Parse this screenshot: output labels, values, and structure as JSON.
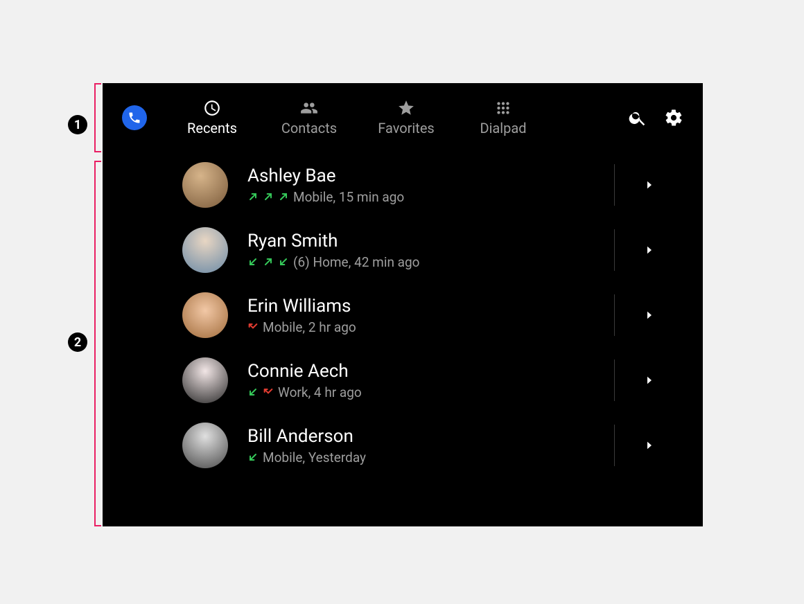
{
  "annotations": {
    "badge1": "1",
    "badge2": "2"
  },
  "header": {
    "tabs": [
      {
        "id": "recents",
        "label": "Recents",
        "active": true
      },
      {
        "id": "contacts",
        "label": "Contacts",
        "active": false
      },
      {
        "id": "favorites",
        "label": "Favorites",
        "active": false
      },
      {
        "id": "dialpad",
        "label": "Dialpad",
        "active": false
      }
    ]
  },
  "calls": [
    {
      "name": "Ashley Bae",
      "icons": [
        "out",
        "out",
        "out"
      ],
      "meta": "Mobile, 15 min ago",
      "avatar_class": "av-grad1"
    },
    {
      "name": "Ryan Smith",
      "icons": [
        "in",
        "out",
        "in"
      ],
      "meta": "(6) Home, 42 min ago",
      "avatar_class": "av-grad2"
    },
    {
      "name": "Erin Williams",
      "icons": [
        "missed"
      ],
      "meta": "Mobile, 2 hr ago",
      "avatar_class": "av-grad3"
    },
    {
      "name": "Connie Aech",
      "icons": [
        "in",
        "missed"
      ],
      "meta": "Work, 4 hr ago",
      "avatar_class": "av-grad4"
    },
    {
      "name": "Bill Anderson",
      "icons": [
        "in"
      ],
      "meta": "Mobile, Yesterday",
      "avatar_class": "av-grad5"
    }
  ]
}
